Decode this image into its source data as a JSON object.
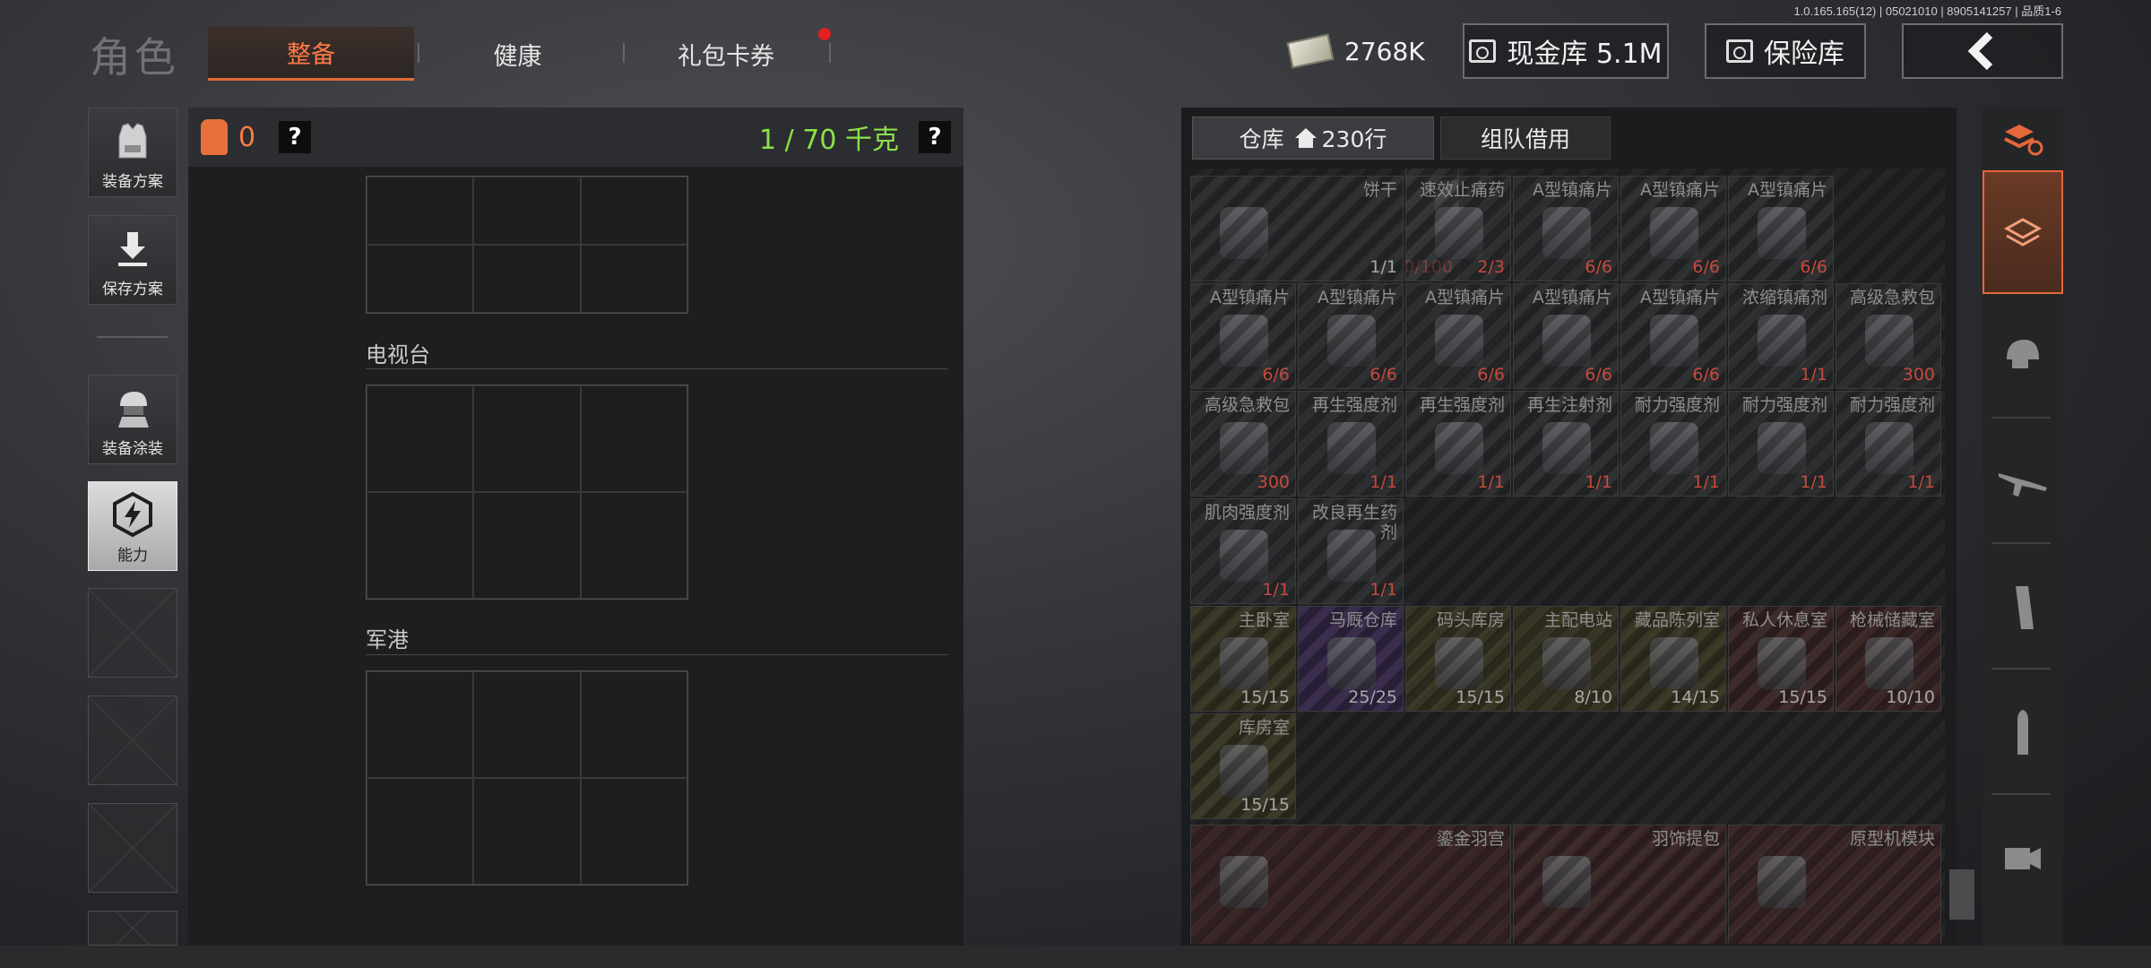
{
  "version": "1.0.165.165(12) | 05021010 | 8905141257 | 品质1-6",
  "header": {
    "title": "角色",
    "tabs": [
      {
        "label": "整备",
        "active": true
      },
      {
        "label": "健康",
        "active": false
      },
      {
        "label": "礼包卡券",
        "active": false,
        "badge": "red-dot"
      }
    ],
    "money": "2768K",
    "cash_vault": "现金库 5.1M",
    "safe_box": "保险库",
    "back_icon": "back-arrow-icon"
  },
  "tools": [
    {
      "label": "装备方案",
      "icon": "armor-vest-icon",
      "active": false
    },
    {
      "label": "保存方案",
      "icon": "download-icon",
      "active": false
    },
    {
      "label": "装备涂装",
      "icon": "helmet-soldier-icon",
      "active": false
    },
    {
      "label": "能力",
      "icon": "lightning-hex-icon",
      "active": true
    }
  ],
  "loadout": {
    "vest_count": "0",
    "help": "?",
    "weight": "1 / 70 千克",
    "maps": [
      "电视台",
      "军港"
    ]
  },
  "warehouse": {
    "tab_label": "仓库",
    "rows": "230行",
    "team_tab": "组队借用",
    "items": [
      {
        "name": "饼干",
        "count": "1/1",
        "tone": "w"
      },
      {
        "name": "",
        "count": "100/100",
        "tone": "r"
      },
      {
        "name": "速效止痛药",
        "count": "2/3",
        "tone": "r"
      },
      {
        "name": "A型镇痛片",
        "count": "6/6",
        "tone": "r"
      },
      {
        "name": "A型镇痛片",
        "count": "6/6",
        "tone": "r"
      },
      {
        "name": "A型镇痛片",
        "count": "6/6",
        "tone": "r"
      },
      {
        "name": "A型镇痛片",
        "count": "6/6",
        "tone": "r"
      },
      {
        "name": "A型镇痛片",
        "count": "6/6",
        "tone": "r"
      },
      {
        "name": "A型镇痛片",
        "count": "6/6",
        "tone": "r"
      },
      {
        "name": "A型镇痛片",
        "count": "6/6",
        "tone": "r"
      },
      {
        "name": "A型镇痛片",
        "count": "6/6",
        "tone": "r"
      },
      {
        "name": "浓缩镇痛剂",
        "count": "1/1",
        "tone": "r"
      },
      {
        "name": "高级急救包",
        "count": "300",
        "tone": "r"
      },
      {
        "name": "高级急救包",
        "count": "300",
        "tone": "r"
      },
      {
        "name": "再生强度剂",
        "count": "1/1",
        "tone": "r"
      },
      {
        "name": "再生强度剂",
        "count": "1/1",
        "tone": "r"
      },
      {
        "name": "再生注射剂",
        "count": "1/1",
        "tone": "r"
      },
      {
        "name": "耐力强度剂",
        "count": "1/1",
        "tone": "r"
      },
      {
        "name": "耐力强度剂",
        "count": "1/1",
        "tone": "r"
      },
      {
        "name": "耐力强度剂",
        "count": "1/1",
        "tone": "r"
      },
      {
        "name": "肌肉强度剂",
        "count": "1/1",
        "tone": "r"
      },
      {
        "name": "改良再生药剂",
        "count": "1/1",
        "tone": "r"
      }
    ],
    "keys": [
      {
        "name": "主卧室",
        "count": "15/15"
      },
      {
        "name": "马厩仓库",
        "count": "25/25"
      },
      {
        "name": "码头库房",
        "count": "15/15"
      },
      {
        "name": "主配电站",
        "count": "8/10"
      },
      {
        "name": "藏品陈列室",
        "count": "14/15"
      },
      {
        "name": "私人休息室",
        "count": "15/15"
      },
      {
        "name": "枪械储藏室",
        "count": "10/10"
      },
      {
        "name": "库房室",
        "count": "15/15"
      }
    ],
    "large_items": [
      "鎏金羽宫",
      "羽饰提包",
      "原型机模块"
    ]
  },
  "categories": [
    "all-items-icon",
    "stack-icon",
    "helmet-icon",
    "rifle-icon",
    "magazine-icon",
    "ammo-icon",
    "scope-icon"
  ]
}
